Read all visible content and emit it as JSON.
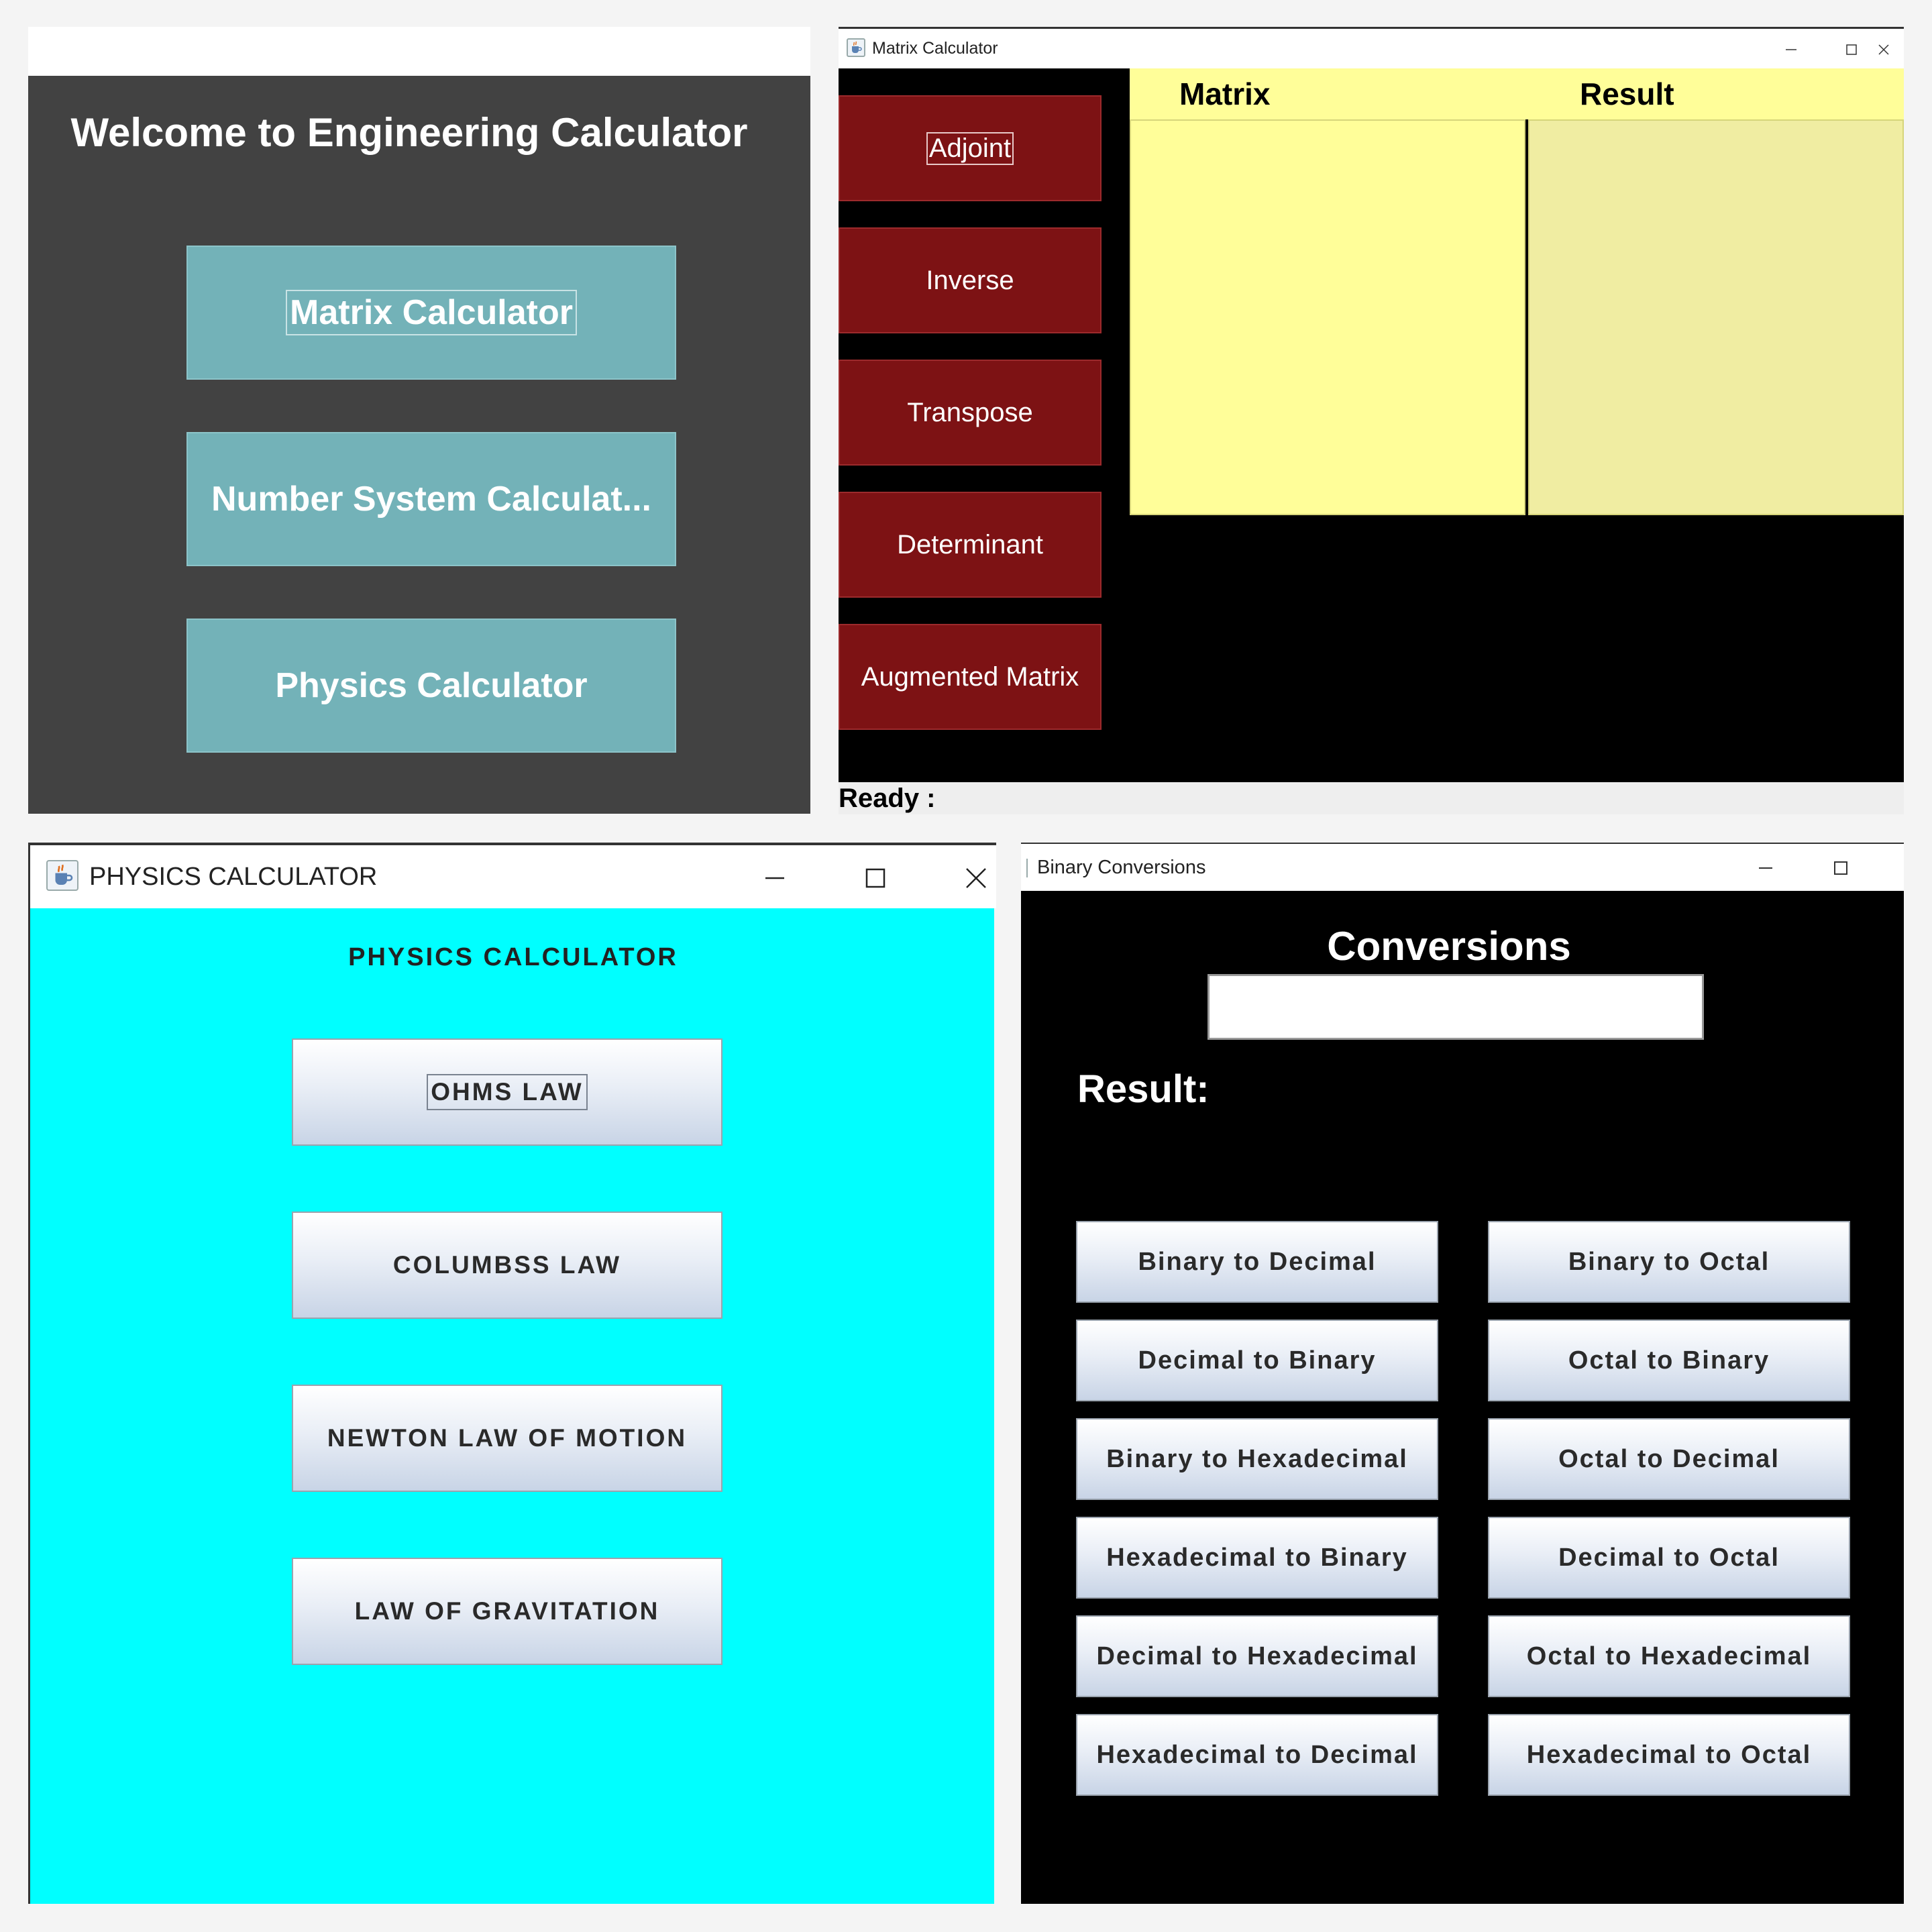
{
  "welcome": {
    "title": "Welcome to Engineering Calculator",
    "buttons": [
      "Matrix Calculator",
      "Number System Calculat...",
      "Physics Calculator"
    ]
  },
  "matrix": {
    "window_title": "Matrix Calculator",
    "buttons": [
      "Adjoint",
      "Inverse",
      "Transpose",
      "Determinant",
      "Augmented Matrix"
    ],
    "col_matrix": "Matrix",
    "col_result": "Result",
    "status": "Ready :"
  },
  "physics": {
    "window_title": "PHYSICS CALCULATOR",
    "heading": "PHYSICS CALCULATOR",
    "buttons": [
      "OHMS LAW",
      "COLUMBSS LAW",
      "NEWTON LAW OF MOTION",
      "LAW OF GRAVITATION"
    ]
  },
  "binary": {
    "window_title": "Binary Conversions",
    "heading": "Conversions",
    "input_value": "",
    "result_label": "Result:",
    "left_buttons": [
      "Binary to Decimal",
      "Decimal to Binary",
      "Binary to Hexadecimal",
      "Hexadecimal to Binary",
      "Decimal to Hexadecimal",
      "Hexadecimal to Decimal"
    ],
    "right_buttons": [
      "Binary to Octal",
      "Octal to Binary",
      "Octal to Decimal",
      "Decimal to Octal",
      "Octal to Hexadecimal",
      "Hexadecimal to Octal"
    ]
  },
  "icons": {
    "window_controls": [
      "minimize-icon",
      "maximize-icon",
      "close-icon"
    ],
    "app_icon": "java-cup-icon"
  },
  "colors": {
    "welcome_bg": "#424242",
    "teal_button": "#73b2b8",
    "matrix_button": "#7d1214",
    "matrix_area": "#fffe99",
    "physics_bg": "#00ffff",
    "conversions_bg": "#000000"
  }
}
